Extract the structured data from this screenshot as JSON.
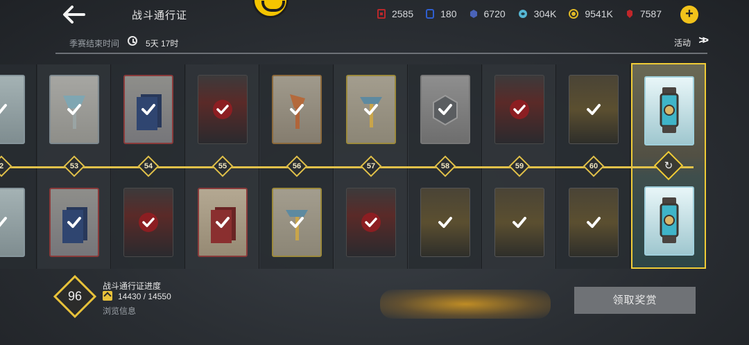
{
  "header": {
    "title": "战斗通行证",
    "currencies": [
      {
        "icon": "red-ticket-icon",
        "color": "#b8282b",
        "value": "2585"
      },
      {
        "icon": "blue-card-icon",
        "color": "#2f5fd0",
        "value": "180"
      },
      {
        "icon": "blue-hex-icon",
        "color": "#4a63b8",
        "value": "6720"
      },
      {
        "icon": "cyan-swirl-icon",
        "color": "#56b7d4",
        "value": "304K"
      },
      {
        "icon": "gold-coin-icon",
        "color": "#e0b926",
        "value": "9541K"
      },
      {
        "icon": "red-gem-icon",
        "color": "#c0262a",
        "value": "7587"
      }
    ]
  },
  "season": {
    "label": "季赛结束时间",
    "time": "5天 17时",
    "activity_label": "活动"
  },
  "levels": [
    "2",
    "53",
    "54",
    "55",
    "56",
    "57",
    "58",
    "59",
    "60"
  ],
  "final_node_symbol": "↻",
  "progress": {
    "level": "96",
    "title": "战斗通行证进度",
    "value": "14430 / 14550",
    "fraction": 0.9918,
    "browse_label": "浏览信息"
  },
  "claim_button": "领取奖赏",
  "colors": {
    "accent": "#e1c14a",
    "highlight": "#f0cc36"
  }
}
